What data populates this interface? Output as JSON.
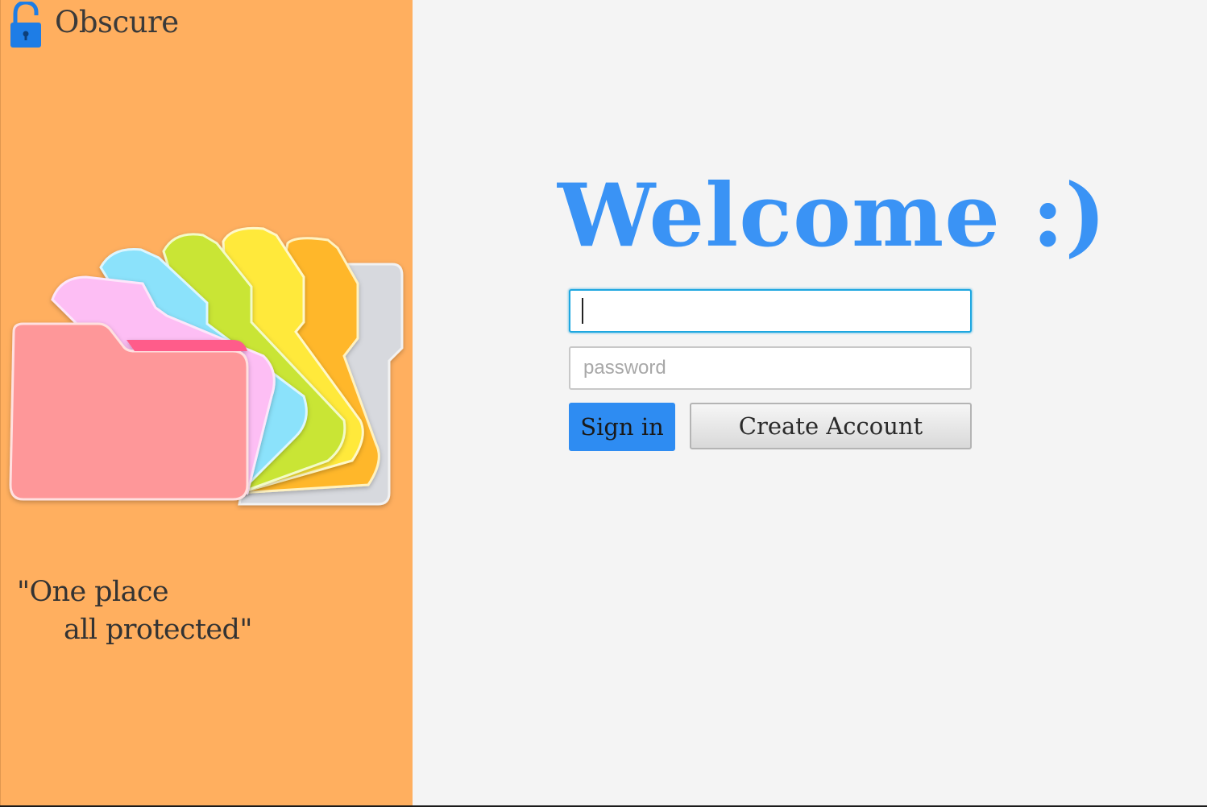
{
  "brand": {
    "name": "Obscure",
    "icon": "lock-icon"
  },
  "sidebar": {
    "tagline_line1": "\"One place",
    "tagline_line2": "all protected\"",
    "illustration": "folders-fan-illustration"
  },
  "main": {
    "heading": "Welcome :)",
    "username": {
      "value": "",
      "placeholder": ""
    },
    "password": {
      "value": "",
      "placeholder": "password"
    },
    "signin_label": "Sign in",
    "create_label": "Create Account"
  },
  "colors": {
    "sidebar_bg": "#ffaf5f",
    "main_bg": "#f4f4f4",
    "accent": "#3a93f5",
    "signin_bg": "#2e8cf2",
    "focus_border": "#1ea7e0"
  }
}
